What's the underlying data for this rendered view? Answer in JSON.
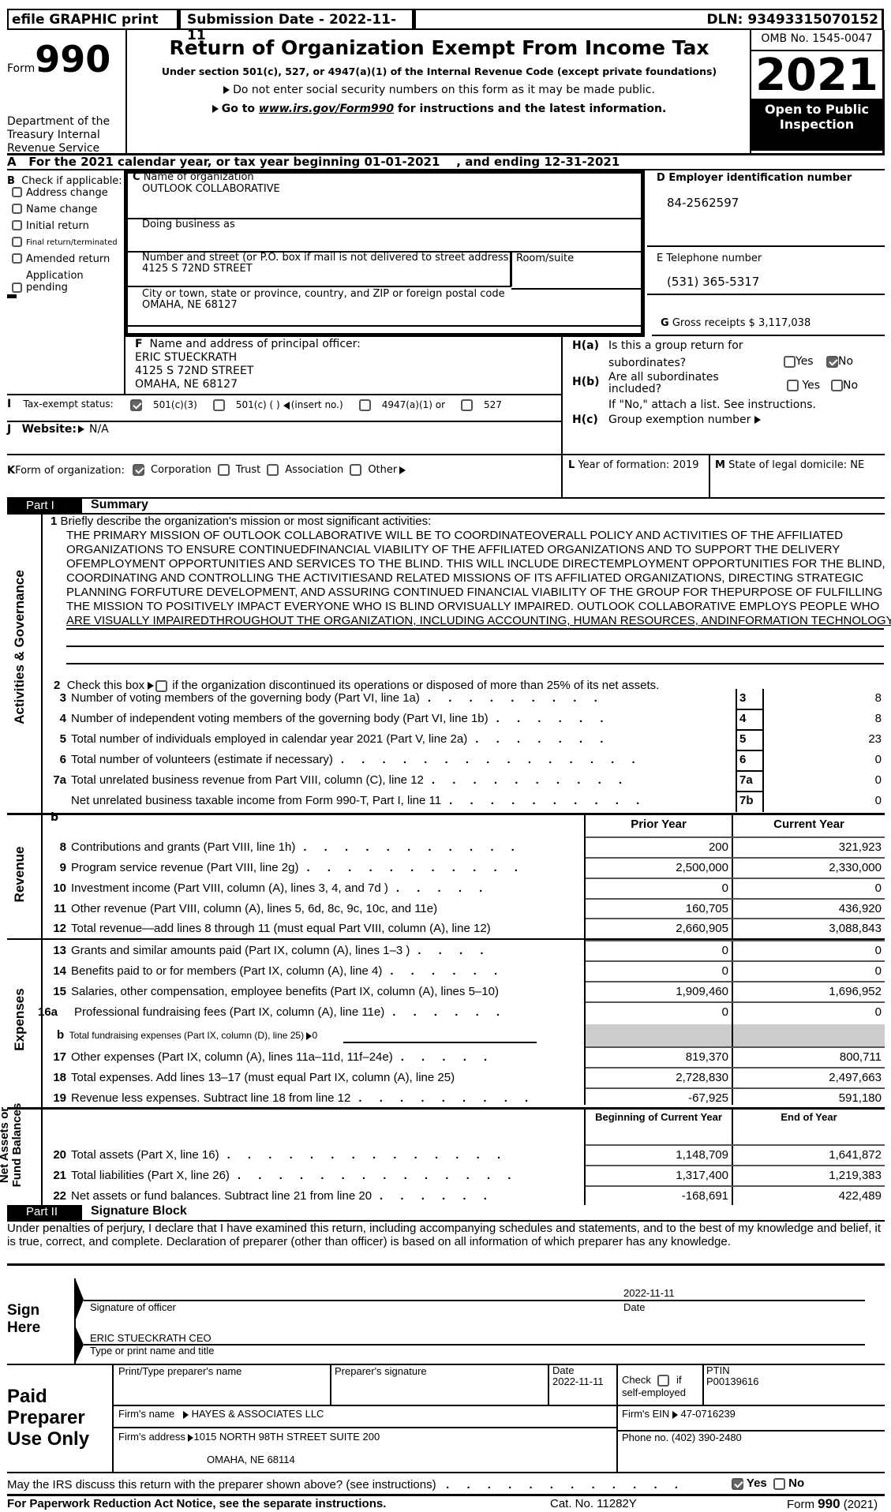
{
  "header": {
    "efile": "efile GRAPHIC print",
    "submission": "Submission Date - 2022-11-11",
    "dln": "DLN: 93493315070152",
    "form_word": "Form",
    "form_number": "990",
    "title": "Return of Organization Exempt From Income Tax",
    "subtitle": "Under section 501(c), 527, or 4947(a)(1) of the Internal Revenue Code (except private foundations)",
    "notice1": "Do not enter social security numbers on this form as it may be made public.",
    "notice2_pre": "Go to ",
    "notice2_link": "www.irs.gov/Form990",
    "notice2_post": " for instructions and the latest information.",
    "dept": "Department of the Treasury Internal Revenue Service",
    "omb": "OMB No. 1545-0047",
    "year": "2021",
    "open_public": "Open to Public Inspection"
  },
  "line_a": "A   For the 2021 calendar year, or tax year beginning 01-01-2021    , and ending 12-31-2021",
  "section_b": {
    "title": "Check if applicable:",
    "letter": "B",
    "items": [
      {
        "label": "Address change",
        "checked": false
      },
      {
        "label": "Name change",
        "checked": false
      },
      {
        "label": "Initial return",
        "checked": false
      },
      {
        "label": "Final return/terminated",
        "checked": false
      },
      {
        "label": "Amended return",
        "checked": false
      },
      {
        "label": "Application pending",
        "checked": false
      }
    ]
  },
  "section_c": {
    "letter": "C",
    "name_label": "Name of organization",
    "name": "OUTLOOK COLLABORATIVE",
    "dba_label": "Doing business as",
    "dba": "",
    "street_label": "Number and street (or P.O. box if mail is not delivered to street address)",
    "street": "4125 S 72ND STREET",
    "room_label": "Room/suite",
    "city_label": "City or town, state or province, country, and ZIP or foreign postal code",
    "city": "OMAHA, NE  68127"
  },
  "section_d": {
    "label": "D Employer identification number",
    "value": "84-2562597"
  },
  "section_e": {
    "label": "E Telephone number",
    "value": "(531) 365-5317"
  },
  "section_g": {
    "letter": "G",
    "label": "Gross receipts $ 3,117,038"
  },
  "section_f": {
    "letter": "F",
    "label": "Name and address of principal officer:",
    "name": "ERIC STUECKRATH",
    "street": "4125 S 72ND STREET",
    "city": "OMAHA, NE  68127"
  },
  "section_h": {
    "ha_label": "H(a)",
    "ha_text1": "Is this a group return for",
    "ha_text2": "subordinates?",
    "hb_label": "H(b)",
    "hb_text": "Are all subordinates included?",
    "hb_note": "If \"No,\" attach a list. See instructions.",
    "hc_label": "H(c)",
    "hc_text": "Group exemption number",
    "yes": "Yes",
    "no": "No",
    "ha_yes": false,
    "ha_no": true,
    "hb_yes": false,
    "hb_no": false
  },
  "section_i": {
    "letter": "I",
    "label": "Tax-exempt status:",
    "options": [
      {
        "label": "501(c)(3)",
        "checked": true
      },
      {
        "label": "501(c) (   )",
        "checked": false
      },
      {
        "label": "4947(a)(1) or",
        "checked": false
      },
      {
        "label": "527",
        "checked": false
      }
    ],
    "insert_no": "(insert no.)"
  },
  "section_j": {
    "letter": "J",
    "label": "Website:",
    "value": "N/A"
  },
  "section_k": {
    "letter": "K",
    "label": "Form of organization:",
    "options": [
      {
        "label": "Corporation",
        "checked": true
      },
      {
        "label": "Trust",
        "checked": false
      },
      {
        "label": "Association",
        "checked": false
      },
      {
        "label": "Other",
        "checked": false
      }
    ]
  },
  "section_l": {
    "letter": "L",
    "label": "Year of formation: 2019"
  },
  "section_m": {
    "letter": "M",
    "label": "State of legal domicile: NE"
  },
  "part1": {
    "tag": "Part I",
    "title": "Summary",
    "side_activities": "Activities & Governance",
    "side_revenue": "Revenue",
    "side_expenses": "Expenses",
    "side_net": "Net Assets or Fund Balances",
    "line1_num": "1",
    "line1_label": "Briefly describe the organization's mission or most significant activities:",
    "mission": [
      "THE PRIMARY MISSION OF OUTLOOK COLLABORATIVE WILL BE TO COORDINATEOVERALL POLICY AND ACTIVITIES OF THE AFFILIATED",
      "ORGANIZATIONS TO ENSURE CONTINUEDFINANCIAL VIABILITY OF THE AFFILIATED ORGANIZATIONS AND TO SUPPORT THE DELIVERY",
      "OFEMPLOYMENT OPPORTUNITIES AND SERVICES TO THE BLIND. THIS WILL INCLUDE DIRECTEMPLOYMENT OPPORTUNITIES FOR THE BLIND,",
      "COORDINATING AND CONTROLLING THE ACTIVITIESAND RELATED MISSIONS OF ITS AFFILIATED ORGANIZATIONS, DIRECTING STRATEGIC",
      "PLANNING FORFUTURE DEVELOPMENT, AND ASSURING CONTINUED FINANCIAL VIABILITY OF THE GROUP FOR THEPURPOSE OF FULFILLING",
      "THE MISSION TO POSITIVELY IMPACT EVERYONE WHO IS BLIND ORVISUALLY IMPAIRED. OUTLOOK COLLABORATIVE EMPLOYS PEOPLE WHO",
      "ARE VISUALLY IMPAIREDTHROUGHOUT THE ORGANIZATION, INCLUDING ACCOUNTING, HUMAN RESOURCES, ANDINFORMATION TECHNOLOGY."
    ],
    "line2_num": "2",
    "line2_pre": "Check this box",
    "line2_post": "if the organization discontinued its operations or disposed of more than 25% of its net assets.",
    "gov_lines": [
      {
        "num": "3",
        "label": "Number of voting members of the governing body (Part VI, line 1a)",
        "dots": ". . . . . . . . .",
        "box": "3",
        "value": "8"
      },
      {
        "num": "4",
        "label": "Number of independent voting members of the governing body (Part VI, line 1b)",
        "dots": ". . . . . .",
        "box": "4",
        "value": "8"
      },
      {
        "num": "5",
        "label": "Total number of individuals employed in calendar year 2021 (Part V, line 2a)",
        "dots": ". . . . . . .",
        "box": "5",
        "value": "23"
      },
      {
        "num": "6",
        "label": "Total number of volunteers (estimate if necessary)",
        "dots": ". . . . . . . . . . . . . . .",
        "box": "6",
        "value": "0"
      },
      {
        "num": "7a",
        "label": "Total unrelated business revenue from Part VIII, column (C), line 12",
        "dots": ". . . . . . . . . .",
        "box": "7a",
        "value": "0"
      },
      {
        "num": "",
        "label": "Net unrelated business taxable income from Form 990-T, Part I, line 11",
        "dots": ". . . . . . . . . .",
        "box": "7b",
        "value": "0"
      }
    ],
    "line7b_letter": "b",
    "col_prior": "Prior Year",
    "col_current": "Current Year",
    "revenue_lines": [
      {
        "num": "8",
        "label": "Contributions and grants (Part VIII, line 1h)",
        "dots": ". . . . . . . . . . .",
        "prior": "200",
        "current": "321,923"
      },
      {
        "num": "9",
        "label": "Program service revenue (Part VIII, line 2g)",
        "dots": ". . . . . . . . . . .",
        "prior": "2,500,000",
        "current": "2,330,000"
      },
      {
        "num": "10",
        "label": "Investment income (Part VIII, column (A), lines 3, 4, and 7d )",
        "dots": ". . . . .",
        "prior": "0",
        "current": "0"
      },
      {
        "num": "11",
        "label": "Other revenue (Part VIII, column (A), lines 5, 6d, 8c, 9c, 10c, and 11e)",
        "dots": "",
        "prior": "160,705",
        "current": "436,920"
      },
      {
        "num": "12",
        "label": "Total revenue—add lines 8 through 11 (must equal Part VIII, column (A), line 12)",
        "dots": "",
        "prior": "2,660,905",
        "current": "3,088,843"
      }
    ],
    "expense_lines": [
      {
        "num": "13",
        "label": "Grants and similar amounts paid (Part IX, column (A), lines 1–3 )",
        "dots": ". . . .",
        "prior": "0",
        "current": "0"
      },
      {
        "num": "14",
        "label": "Benefits paid to or for members (Part IX, column (A), line 4)",
        "dots": ". . . . . .",
        "prior": "0",
        "current": "0"
      },
      {
        "num": "15",
        "label": "Salaries, other compensation, employee benefits (Part IX, column (A), lines 5–10)",
        "dots": "",
        "prior": "1,909,460",
        "current": "1,696,952"
      },
      {
        "num": "16a",
        "label": "Professional fundraising fees (Part IX, column (A), line 11e)",
        "dots": ". . . . . .",
        "prior": "0",
        "current": "0"
      }
    ],
    "line16b_num": "b",
    "line16b_label": "Total fundraising expenses (Part IX, column (D), line 25)",
    "line16b_value": "0",
    "expense_lines2": [
      {
        "num": "17",
        "label": "Other expenses (Part IX, column (A), lines 11a–11d, 11f–24e)",
        "dots": ". . . . .",
        "prior": "819,370",
        "current": "800,711"
      },
      {
        "num": "18",
        "label": "Total expenses. Add lines 13–17 (must equal Part IX, column (A), line 25)",
        "dots": "",
        "prior": "2,728,830",
        "current": "2,497,663"
      },
      {
        "num": "19",
        "label": "Revenue less expenses. Subtract line 18 from line 12",
        "dots": ". . . . . . . . .",
        "prior": "-67,925",
        "current": "591,180"
      }
    ],
    "col_begin": "Beginning of Current Year",
    "col_end": "End of Year",
    "net_lines": [
      {
        "num": "20",
        "label": "Total assets (Part X, line 16)",
        "dots": ". . . . . . . . . . . . . .",
        "begin": "1,148,709",
        "end": "1,641,872"
      },
      {
        "num": "21",
        "label": "Total liabilities (Part X, line 26)",
        "dots": ". . . . . . . . . . . . . .",
        "begin": "1,317,400",
        "end": "1,219,383"
      },
      {
        "num": "22",
        "label": "Net assets or fund balances. Subtract line 21 from line 20",
        "dots": ". . . . . .",
        "begin": "-168,691",
        "end": "422,489"
      }
    ]
  },
  "part2": {
    "tag": "Part II",
    "title": "Signature Block",
    "perjury": "Under penalties of perjury, I declare that I have examined this return, including accompanying schedules and statements, and to the best of my knowledge and belief, it is true, correct, and complete. Declaration of preparer (other than officer) is based on all information of which preparer has any knowledge.",
    "sign_here": "Sign Here",
    "sig_label": "Signature of officer",
    "sig_date": "2022-11-11",
    "date_label": "Date",
    "officer_name": "ERIC STUECKRATH  CEO",
    "name_title_label": "Type or print name and title"
  },
  "preparer": {
    "heading": "Paid Preparer Use Only",
    "name_label": "Print/Type preparer's name",
    "sig_label": "Preparer's signature",
    "date_label": "Date",
    "date": "2022-11-11",
    "check_label": "Check",
    "if_label": "if",
    "self_employed": "self-employed",
    "self_employed_checked": false,
    "ptin_label": "PTIN",
    "ptin": "P00139616",
    "firm_name_label": "Firm's name",
    "firm_name": "HAYES & ASSOCIATES LLC",
    "firm_ein_label": "Firm's EIN",
    "firm_ein": "47-0716239",
    "firm_address_label": "Firm's address",
    "firm_address1": "1015 NORTH 98TH STREET SUITE 200",
    "firm_address2": "OMAHA, NE  68114",
    "phone": "Phone no. (402) 390-2480"
  },
  "footer": {
    "discuss": "May the IRS discuss this return with the preparer shown above? (see instructions)",
    "discuss_dots": ". . . . . . . . . . . .",
    "yes": "Yes",
    "no": "No",
    "discuss_yes": true,
    "discuss_no": false,
    "paperwork": "For Paperwork Reduction Act Notice, see the separate instructions.",
    "cat": "Cat. No. 11282Y",
    "form_ref_pre": "Form ",
    "form_ref_num": "990",
    "form_ref_post": " (2021)"
  }
}
